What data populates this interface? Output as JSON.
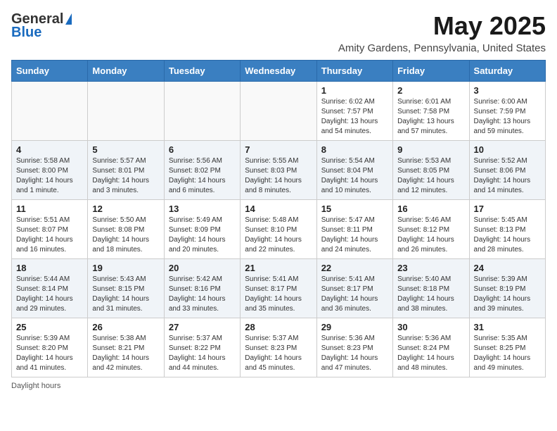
{
  "header": {
    "logo_general": "General",
    "logo_blue": "Blue",
    "month_title": "May 2025",
    "location": "Amity Gardens, Pennsylvania, United States"
  },
  "days_of_week": [
    "Sunday",
    "Monday",
    "Tuesday",
    "Wednesday",
    "Thursday",
    "Friday",
    "Saturday"
  ],
  "weeks": [
    [
      {
        "day": "",
        "info": ""
      },
      {
        "day": "",
        "info": ""
      },
      {
        "day": "",
        "info": ""
      },
      {
        "day": "",
        "info": ""
      },
      {
        "day": "1",
        "info": "Sunrise: 6:02 AM\nSunset: 7:57 PM\nDaylight: 13 hours and 54 minutes."
      },
      {
        "day": "2",
        "info": "Sunrise: 6:01 AM\nSunset: 7:58 PM\nDaylight: 13 hours and 57 minutes."
      },
      {
        "day": "3",
        "info": "Sunrise: 6:00 AM\nSunset: 7:59 PM\nDaylight: 13 hours and 59 minutes."
      }
    ],
    [
      {
        "day": "4",
        "info": "Sunrise: 5:58 AM\nSunset: 8:00 PM\nDaylight: 14 hours and 1 minute."
      },
      {
        "day": "5",
        "info": "Sunrise: 5:57 AM\nSunset: 8:01 PM\nDaylight: 14 hours and 3 minutes."
      },
      {
        "day": "6",
        "info": "Sunrise: 5:56 AM\nSunset: 8:02 PM\nDaylight: 14 hours and 6 minutes."
      },
      {
        "day": "7",
        "info": "Sunrise: 5:55 AM\nSunset: 8:03 PM\nDaylight: 14 hours and 8 minutes."
      },
      {
        "day": "8",
        "info": "Sunrise: 5:54 AM\nSunset: 8:04 PM\nDaylight: 14 hours and 10 minutes."
      },
      {
        "day": "9",
        "info": "Sunrise: 5:53 AM\nSunset: 8:05 PM\nDaylight: 14 hours and 12 minutes."
      },
      {
        "day": "10",
        "info": "Sunrise: 5:52 AM\nSunset: 8:06 PM\nDaylight: 14 hours and 14 minutes."
      }
    ],
    [
      {
        "day": "11",
        "info": "Sunrise: 5:51 AM\nSunset: 8:07 PM\nDaylight: 14 hours and 16 minutes."
      },
      {
        "day": "12",
        "info": "Sunrise: 5:50 AM\nSunset: 8:08 PM\nDaylight: 14 hours and 18 minutes."
      },
      {
        "day": "13",
        "info": "Sunrise: 5:49 AM\nSunset: 8:09 PM\nDaylight: 14 hours and 20 minutes."
      },
      {
        "day": "14",
        "info": "Sunrise: 5:48 AM\nSunset: 8:10 PM\nDaylight: 14 hours and 22 minutes."
      },
      {
        "day": "15",
        "info": "Sunrise: 5:47 AM\nSunset: 8:11 PM\nDaylight: 14 hours and 24 minutes."
      },
      {
        "day": "16",
        "info": "Sunrise: 5:46 AM\nSunset: 8:12 PM\nDaylight: 14 hours and 26 minutes."
      },
      {
        "day": "17",
        "info": "Sunrise: 5:45 AM\nSunset: 8:13 PM\nDaylight: 14 hours and 28 minutes."
      }
    ],
    [
      {
        "day": "18",
        "info": "Sunrise: 5:44 AM\nSunset: 8:14 PM\nDaylight: 14 hours and 29 minutes."
      },
      {
        "day": "19",
        "info": "Sunrise: 5:43 AM\nSunset: 8:15 PM\nDaylight: 14 hours and 31 minutes."
      },
      {
        "day": "20",
        "info": "Sunrise: 5:42 AM\nSunset: 8:16 PM\nDaylight: 14 hours and 33 minutes."
      },
      {
        "day": "21",
        "info": "Sunrise: 5:41 AM\nSunset: 8:17 PM\nDaylight: 14 hours and 35 minutes."
      },
      {
        "day": "22",
        "info": "Sunrise: 5:41 AM\nSunset: 8:17 PM\nDaylight: 14 hours and 36 minutes."
      },
      {
        "day": "23",
        "info": "Sunrise: 5:40 AM\nSunset: 8:18 PM\nDaylight: 14 hours and 38 minutes."
      },
      {
        "day": "24",
        "info": "Sunrise: 5:39 AM\nSunset: 8:19 PM\nDaylight: 14 hours and 39 minutes."
      }
    ],
    [
      {
        "day": "25",
        "info": "Sunrise: 5:39 AM\nSunset: 8:20 PM\nDaylight: 14 hours and 41 minutes."
      },
      {
        "day": "26",
        "info": "Sunrise: 5:38 AM\nSunset: 8:21 PM\nDaylight: 14 hours and 42 minutes."
      },
      {
        "day": "27",
        "info": "Sunrise: 5:37 AM\nSunset: 8:22 PM\nDaylight: 14 hours and 44 minutes."
      },
      {
        "day": "28",
        "info": "Sunrise: 5:37 AM\nSunset: 8:23 PM\nDaylight: 14 hours and 45 minutes."
      },
      {
        "day": "29",
        "info": "Sunrise: 5:36 AM\nSunset: 8:23 PM\nDaylight: 14 hours and 47 minutes."
      },
      {
        "day": "30",
        "info": "Sunrise: 5:36 AM\nSunset: 8:24 PM\nDaylight: 14 hours and 48 minutes."
      },
      {
        "day": "31",
        "info": "Sunrise: 5:35 AM\nSunset: 8:25 PM\nDaylight: 14 hours and 49 minutes."
      }
    ]
  ],
  "footer": {
    "note": "Daylight hours"
  }
}
